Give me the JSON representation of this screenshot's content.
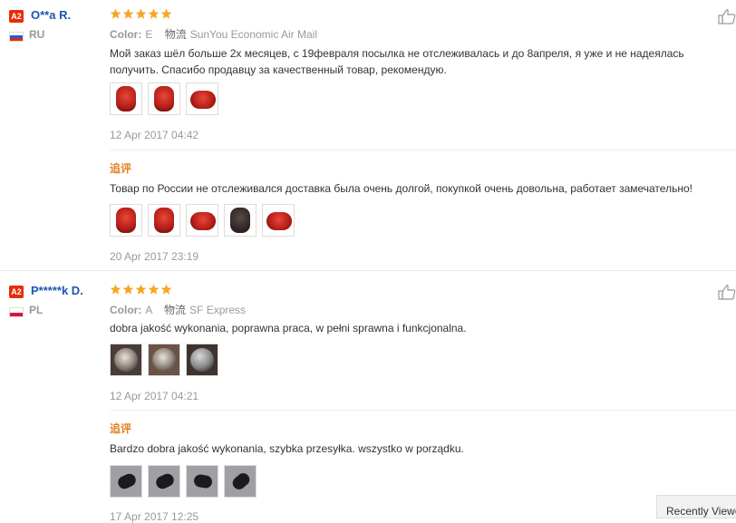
{
  "reviews": [
    {
      "level": "A2",
      "user": "O**a R.",
      "country": "RU",
      "rating": 5,
      "color_label": "Color:",
      "color_value": "E",
      "logistics_label": "物流",
      "logistics_value": "SunYou Economic Air Mail",
      "text": "Мой заказ шёл больше 2х месяцев, с 19февраля посылка не отслеживалась и до 8апреля, я уже и не надеялась получить. Спасибо продавцу за качественный товар, рекомендую.",
      "date": "12 Apr 2017 04:42",
      "followup_label": "追评",
      "followup_text": "Товар по России не отслеживался доставка была очень долгой, покупкой очень довольна, работает замечательно!",
      "followup_date": "20 Apr 2017 23:19"
    },
    {
      "level": "A2",
      "user": "P*****k D.",
      "country": "PL",
      "rating": 5,
      "color_label": "Color:",
      "color_value": "A",
      "logistics_label": "物流",
      "logistics_value": "SF Express",
      "text": "dobra jakość wykonania, poprawna praca, w pełni sprawna i funkcjonalna.",
      "date": "12 Apr 2017 04:21",
      "followup_label": "追评",
      "followup_text": "Bardzo dobra jakość wykonania, szybka przesyłka. wszystko w porządku.",
      "followup_date": "17 Apr 2017 12:25"
    }
  ],
  "recently_viewed": "Recently Viewed",
  "colors": {
    "star": "#f6a623",
    "username": "#1c57b2",
    "followup": "#e5811d",
    "badge": "#e62e04"
  },
  "icons": [
    "star-icon",
    "thumbs-up-icon",
    "flag-ru-icon",
    "flag-pl-icon"
  ]
}
